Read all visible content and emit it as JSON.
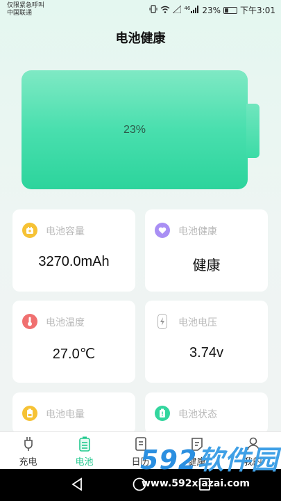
{
  "status_bar": {
    "line1": "仅限紧急呼叫",
    "line2": "中国联通",
    "signal_label": "46",
    "battery_text": "23%",
    "time": "下午3:01"
  },
  "page": {
    "title": "电池健康"
  },
  "battery": {
    "percent_text": "23%",
    "level": 0.23
  },
  "cards": [
    {
      "label": "电池容量",
      "value": "3270.0mAh",
      "icon": "battery-capacity-icon",
      "color": "#f6c235"
    },
    {
      "label": "电池健康",
      "value": "健康",
      "icon": "heart-icon",
      "color": "#a98ff4"
    },
    {
      "label": "电池温度",
      "value": "27.0℃",
      "icon": "thermometer-icon",
      "color": "#f07070"
    },
    {
      "label": "电池电压",
      "value": "3.74v",
      "icon": "voltage-icon",
      "color": "#b5b5b5"
    },
    {
      "label": "电池电量",
      "value": "",
      "icon": "battery-level-icon",
      "color": "#f6c235"
    },
    {
      "label": "电池状态",
      "value": "",
      "icon": "battery-status-icon",
      "color": "#33d69e"
    }
  ],
  "tabs": [
    {
      "label": "充电",
      "icon": "plug-icon",
      "active": false
    },
    {
      "label": "电池",
      "icon": "battery-icon",
      "active": true
    },
    {
      "label": "日历",
      "icon": "document-icon",
      "active": false
    },
    {
      "label": "健康",
      "icon": "note-icon",
      "active": false
    },
    {
      "label": "我的",
      "icon": "user-icon",
      "active": false
    }
  ],
  "watermark": {
    "text_num": "592",
    "text_cn": "软件园",
    "url": "www.592xiazai.com"
  },
  "colors": {
    "accent": "#24c98f",
    "battery_top": "#7fe9c4",
    "battery_bottom": "#2cd49c"
  }
}
